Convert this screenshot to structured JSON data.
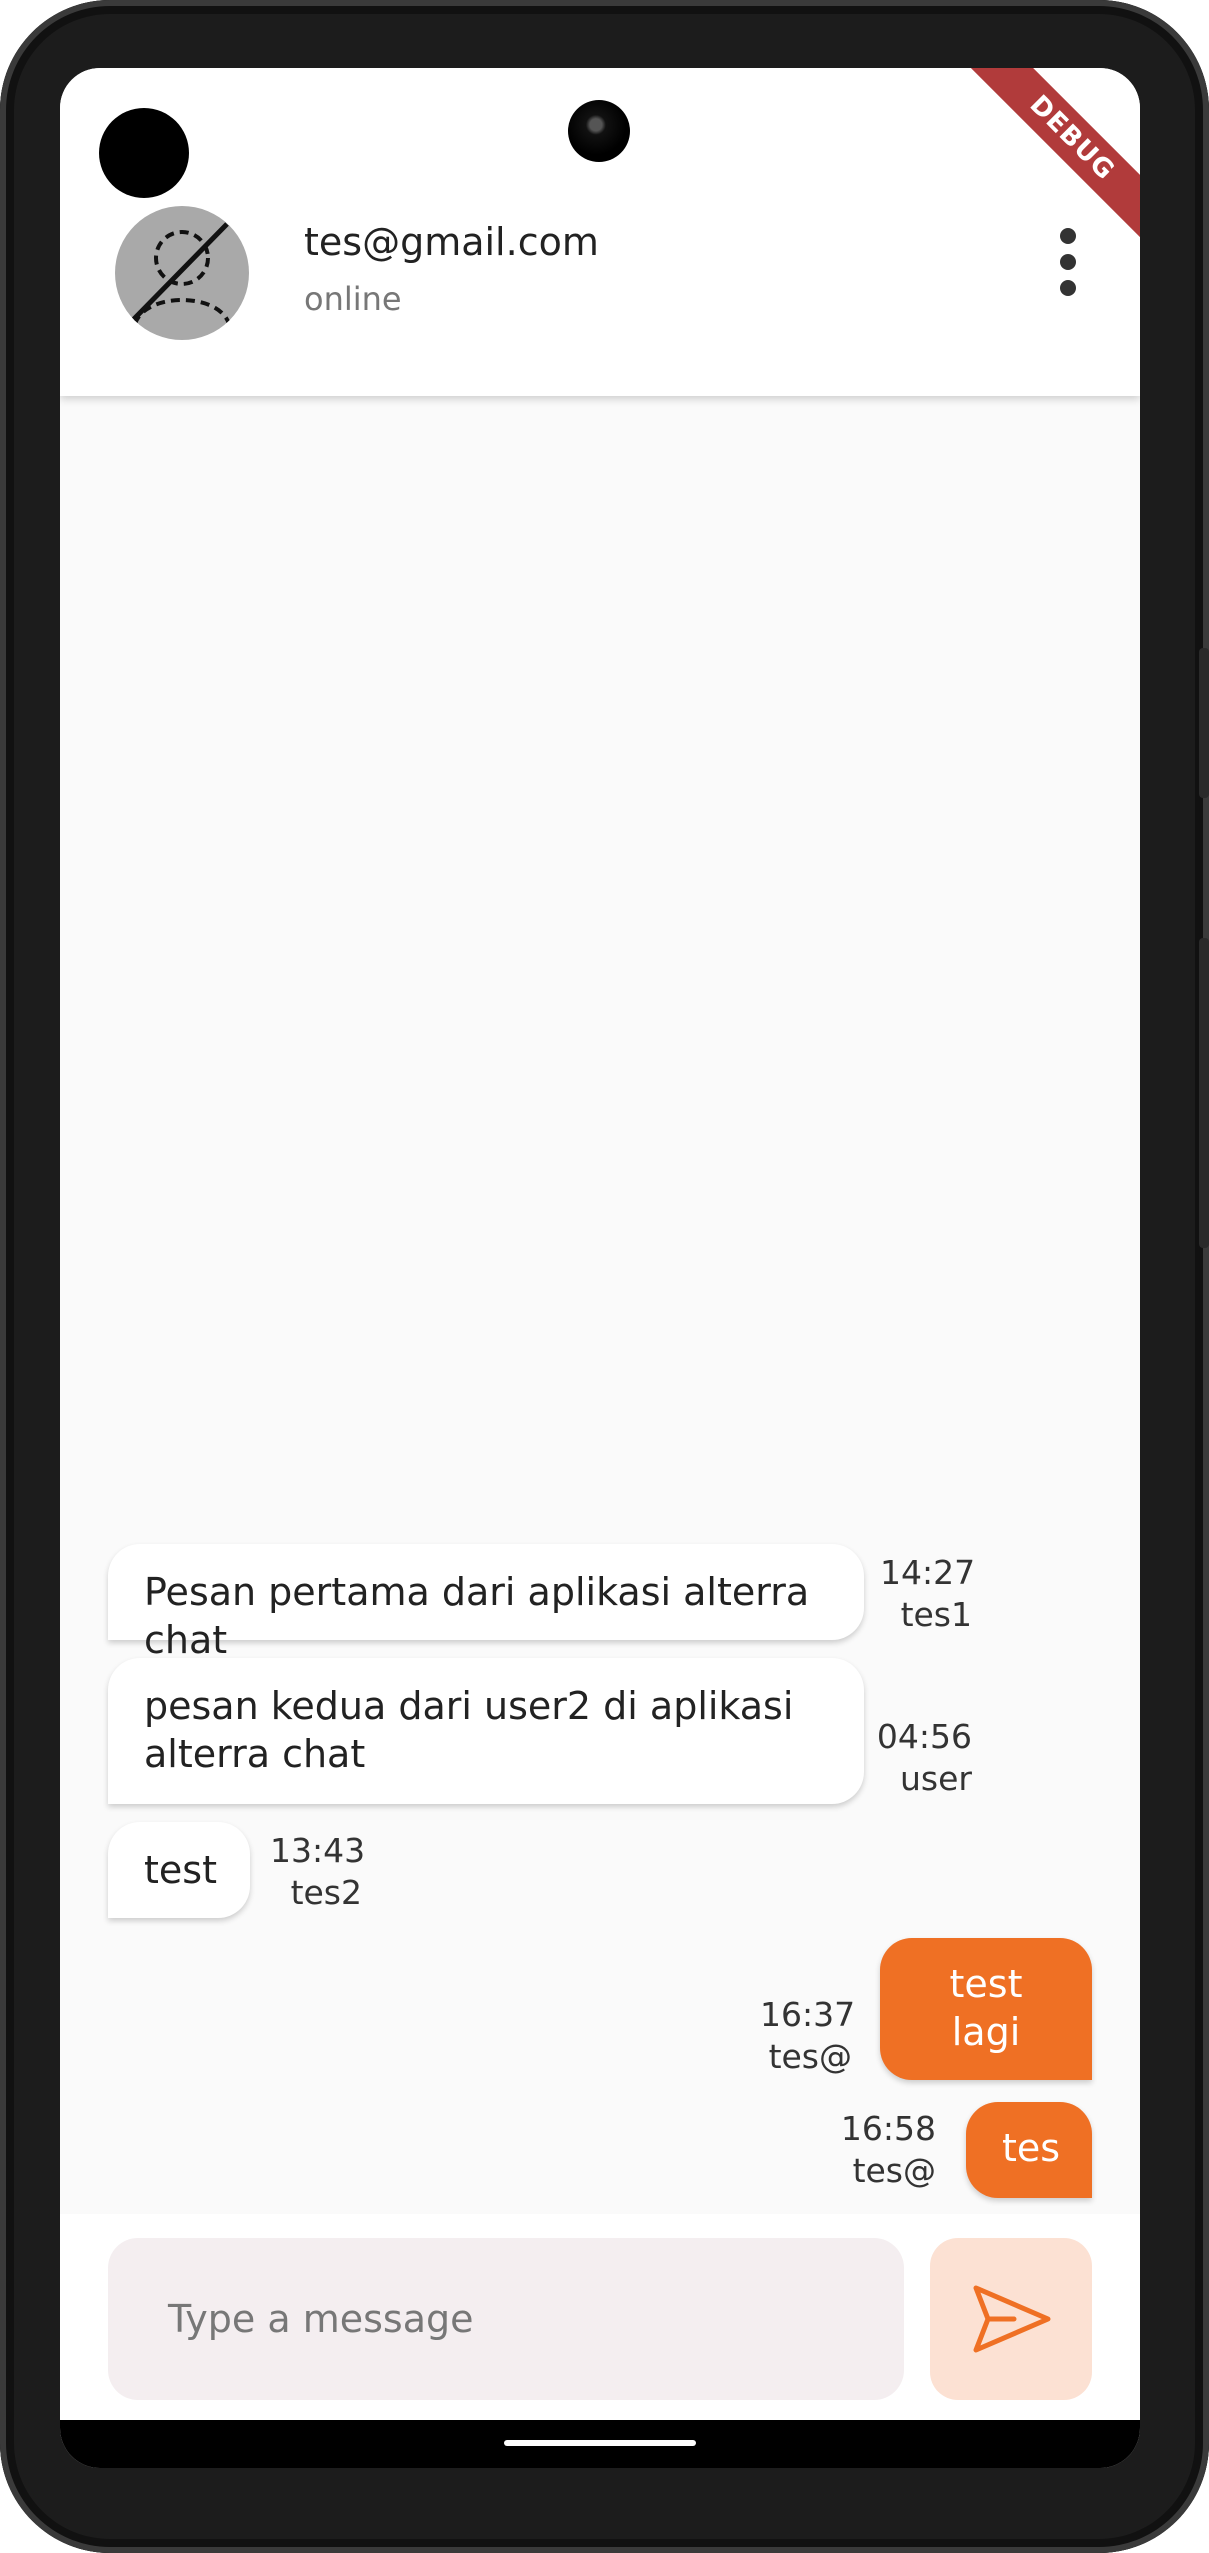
{
  "debug_banner": "DEBUG",
  "header": {
    "contact_name": "tes@gmail.com",
    "status": "online"
  },
  "messages": [
    {
      "text": "Pesan pertama dari aplikasi alterra chat",
      "time": "14:27",
      "sender": "tes1",
      "direction": "incoming"
    },
    {
      "text": "pesan kedua dari user2 di aplikasi alterra chat",
      "time": "04:56",
      "sender": "user",
      "direction": "incoming"
    },
    {
      "text": "test",
      "time": "13:43",
      "sender": "tes2",
      "direction": "incoming"
    },
    {
      "text": "test lagi",
      "time": "16:37",
      "sender": "tes@",
      "direction": "outgoing"
    },
    {
      "text": "tes",
      "time": "16:58",
      "sender": "tes@",
      "direction": "outgoing"
    }
  ],
  "composer": {
    "placeholder": "Type a message"
  },
  "colors": {
    "accent": "#ef7024",
    "send_button_bg": "#fce1d3",
    "input_bg": "#f4eef0",
    "debug_ribbon": "#b13b3b"
  },
  "icons": {
    "avatar": "no-image-person-icon",
    "menu": "more-vert-icon",
    "send": "send-icon"
  }
}
